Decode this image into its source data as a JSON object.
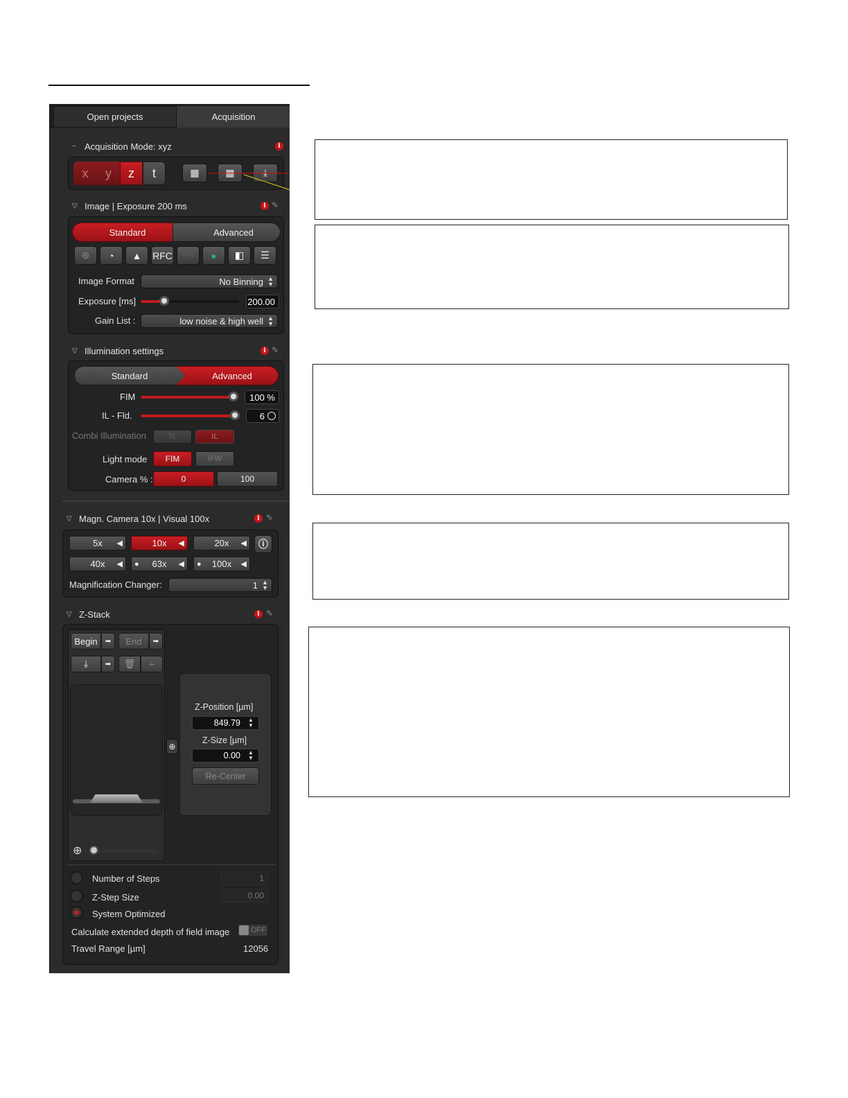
{
  "tabs": {
    "open_projects": "Open projects",
    "acquisition": "Acquisition"
  },
  "acq_mode": {
    "title": "Acquisition Mode: xyz",
    "axes": [
      "x",
      "y",
      "z",
      "t"
    ]
  },
  "image": {
    "title": "Image | Exposure 200 ms",
    "mode_standard": "Standard",
    "mode_advanced": "Advanced",
    "tool_rfc": "RFC",
    "image_format_label": "Image Format",
    "image_format_value": "No Binning",
    "exposure_label": "Exposure [ms]",
    "exposure_value": "200.00",
    "exposure_level": 0.24,
    "gain_label": "Gain List :",
    "gain_value": "low noise & high well"
  },
  "illumination": {
    "title": "Illumination settings",
    "mode_standard": "Standard",
    "mode_advanced": "Advanced",
    "fim_label": "FIM",
    "fim_value": "100 %",
    "fim_level": 1.0,
    "ilfld_label": "IL - Fld.",
    "ilfld_value": "6",
    "ilfld_level": 1.0,
    "combi_label": "Combi Illumination",
    "combi_tl": "TL",
    "combi_il": "IL",
    "light_mode_label": "Light mode",
    "light_fim": "FIM",
    "light_ifw": "IFW",
    "camera_label": "Camera % :",
    "camera_0": "0",
    "camera_100": "100"
  },
  "magnification": {
    "title": "Magn.  Camera 10x | Visual 100x",
    "objectives": [
      "5x",
      "10x",
      "20x",
      "40x",
      "63x",
      "100x"
    ],
    "changer_label": "Magnification Changer:",
    "changer_value": "1"
  },
  "zstack": {
    "title": "Z-Stack",
    "begin": "Begin",
    "end": "End",
    "zpos_label": "Z-Position [µm]",
    "zpos_value": "849.79",
    "zsize_label": "Z-Size [µm]",
    "zsize_value": "0.00",
    "recenter": "Re-Center",
    "steps_label": "Number of Steps",
    "steps_value": "1",
    "stepsize_label": "Z-Step Size",
    "stepsize_value": "0.00",
    "sysopt_label": "System Optimized",
    "edf_label": "Calculate extended depth of field image",
    "edf_toggle": "OFF",
    "travel_label": "Travel Range [µm]",
    "travel_value": "12056"
  },
  "colors": {
    "accent": "#c11a1f",
    "panel": "#2b2b2b",
    "info": "#c8141b"
  }
}
